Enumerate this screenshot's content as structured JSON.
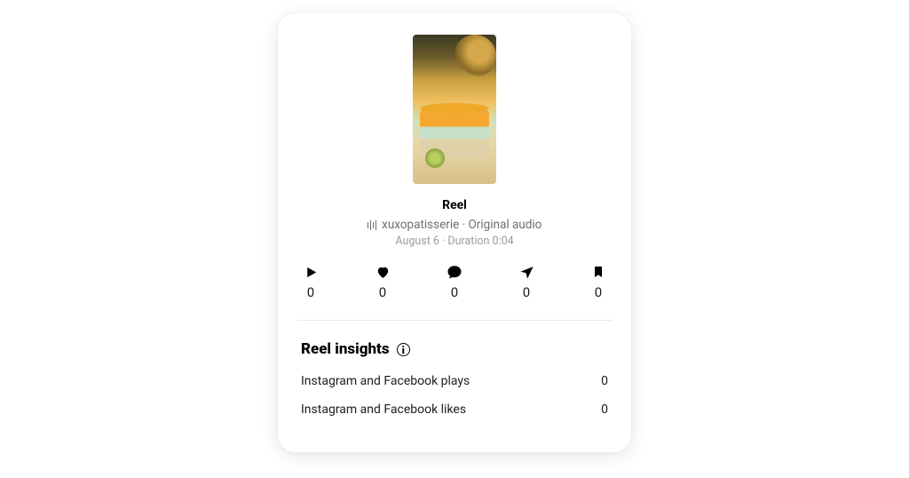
{
  "reel": {
    "title": "Reel",
    "audio": "xuxopatisserie · Original audio",
    "meta": "August 6 · Duration 0:04"
  },
  "stats": {
    "plays": "0",
    "likes": "0",
    "comments": "0",
    "shares": "0",
    "saves": "0"
  },
  "insights": {
    "header": "Reel insights",
    "rows": [
      {
        "label": "Instagram and Facebook plays",
        "value": "0"
      },
      {
        "label": "Instagram and Facebook likes",
        "value": "0"
      }
    ]
  }
}
